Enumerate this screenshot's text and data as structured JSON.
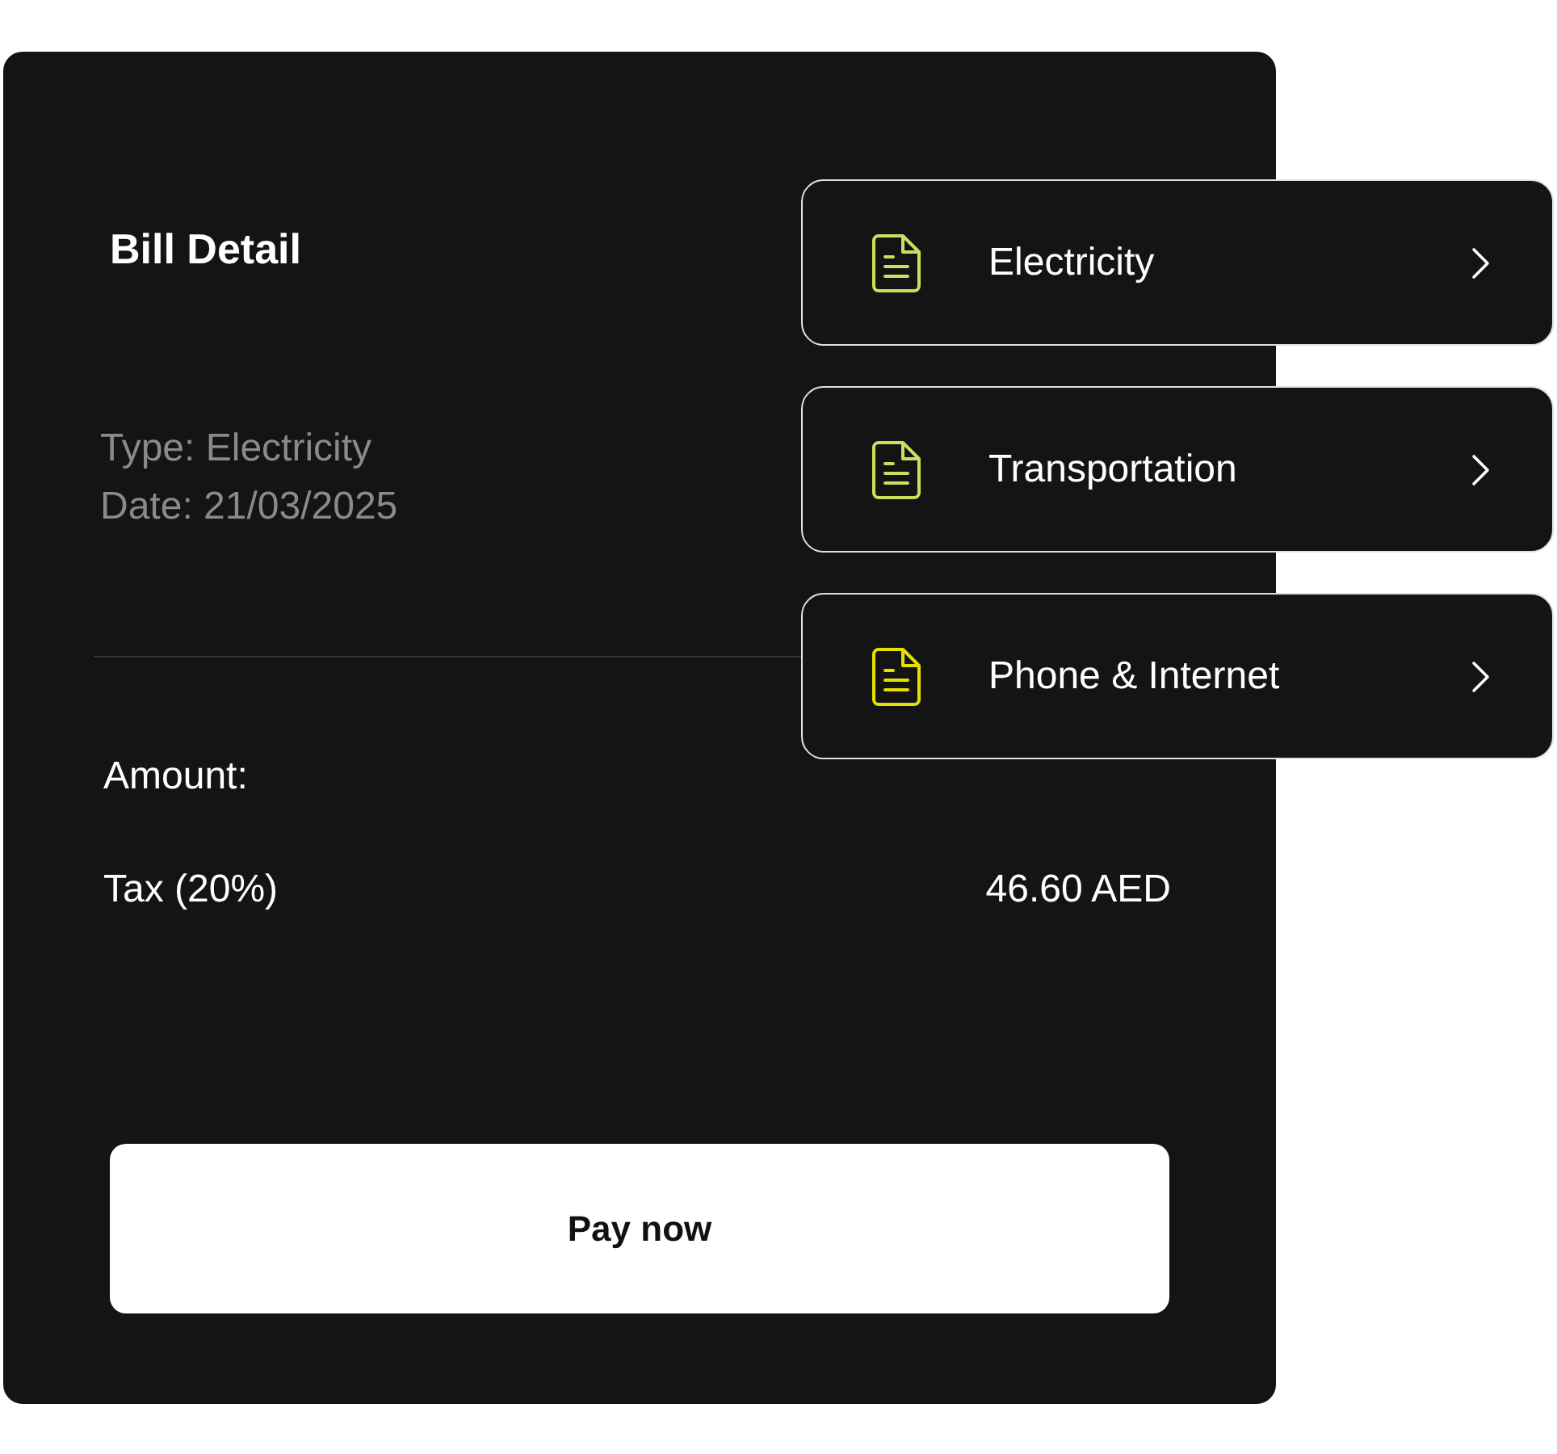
{
  "bill": {
    "title": "Bill Detail",
    "details": [
      "Type: Electricity",
      "Date: 21/03/2025"
    ],
    "lines": [
      {
        "label": "Amount:"
      },
      {
        "label": "Tax (20%)",
        "value": "46.60 AED"
      }
    ],
    "button": "Pay now"
  },
  "menu": {
    "items": [
      {
        "label": "Electricity",
        "color": "#cfdd5c"
      },
      {
        "label": "Transportation",
        "color": "#cfdd5c"
      },
      {
        "label": "Phone & Internet",
        "color": "#e6e000"
      }
    ]
  }
}
